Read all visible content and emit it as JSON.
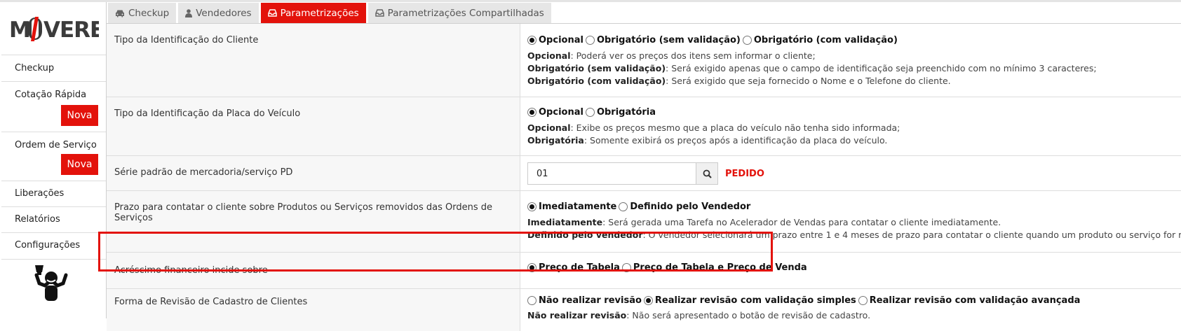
{
  "app": {
    "logo_text": "MOVERE"
  },
  "tabs": [
    {
      "label": "Checkup",
      "icon": "car-icon",
      "active": false
    },
    {
      "label": "Vendedores",
      "icon": "user-icon",
      "active": false
    },
    {
      "label": "Parametrizações",
      "icon": "inbox-icon",
      "active": true
    },
    {
      "label": "Parametrizações Compartilhadas",
      "icon": "inbox-icon",
      "active": false
    }
  ],
  "sidebar": {
    "items": [
      {
        "label": "Checkup"
      },
      {
        "label": "Cotação Rápida",
        "badge": "Nova"
      },
      {
        "label": "Ordem de Serviço",
        "badge": "Nova"
      },
      {
        "label": "Liberações"
      },
      {
        "label": "Relatórios"
      },
      {
        "label": "Configurações"
      }
    ]
  },
  "settings": [
    {
      "label": "Tipo da Identificação do Cliente",
      "options": [
        {
          "label": "Opcional",
          "selected": true
        },
        {
          "label": "Obrigatório (sem validação)",
          "selected": false
        },
        {
          "label": "Obrigatório (com validação)",
          "selected": false
        }
      ],
      "descriptions": [
        {
          "term": "Opcional",
          "text": ": Poderá ver os preços dos itens sem informar o cliente;"
        },
        {
          "term": "Obrigatório (sem validação)",
          "text": ": Será exigido apenas que o campo de identificação seja preenchido com no mínimo 3 caracteres;"
        },
        {
          "term": "Obrigatório (com validação)",
          "text": ": Será exigido que seja fornecido o Nome e o Telefone do cliente."
        }
      ]
    },
    {
      "label": "Tipo da Identificação da Placa do Veículo",
      "options": [
        {
          "label": "Opcional",
          "selected": true
        },
        {
          "label": "Obrigatória",
          "selected": false
        }
      ],
      "descriptions": [
        {
          "term": "Opcional",
          "text": ": Exibe os preços mesmo que a placa do veículo não tenha sido informada;"
        },
        {
          "term": "Obrigatória",
          "text": ": Somente exibirá os preços após a identificação da placa do veículo."
        }
      ]
    },
    {
      "label": "Série padrão de mercadoria/serviço PD",
      "input_value": "01",
      "tag": "PEDIDO"
    },
    {
      "label": "Prazo para contatar o cliente sobre Produtos ou Serviços removidos das Ordens de Serviços",
      "options": [
        {
          "label": "Imediatamente",
          "selected": true
        },
        {
          "label": "Definido pelo Vendedor",
          "selected": false
        }
      ],
      "descriptions": [
        {
          "term": "Imediatamente",
          "text": ": Será gerada uma Tarefa no Acelerador de Vendas para contatar o cliente imediatamente."
        },
        {
          "term": "Definido pelo vendedor",
          "text": ": O vendedor selecionará um prazo entre 1 e 4 meses de prazo para contatar o cliente quando um produto ou serviço for removido"
        }
      ]
    },
    {
      "label": "Acréscimo financeiro incide sobre",
      "options": [
        {
          "label": "Preço de Tabela",
          "selected": true
        },
        {
          "label": "Preço de Tabela e Preço de Venda",
          "selected": false
        }
      ]
    },
    {
      "label": "Forma de Revisão de Cadastro de Clientes",
      "options": [
        {
          "label": "Não realizar revisão",
          "selected": false
        },
        {
          "label": "Realizar revisão com validação simples",
          "selected": true
        },
        {
          "label": "Realizar revisão com validação avançada",
          "selected": false
        }
      ],
      "descriptions": [
        {
          "term": "Não realizar revisão",
          "text": ": Não será apresentado o botão de revisão de cadastro."
        }
      ]
    }
  ],
  "colors": {
    "accent": "#e3120b",
    "highlight_border": "#e3120b"
  }
}
